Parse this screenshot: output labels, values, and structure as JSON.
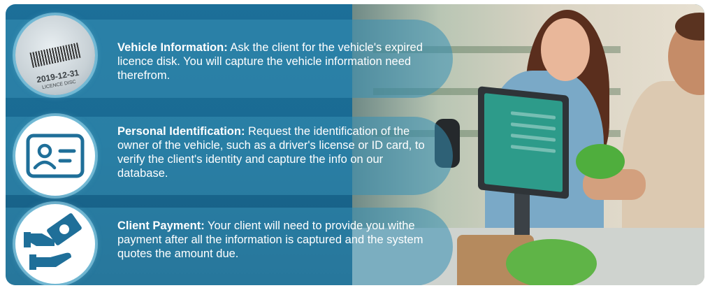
{
  "items": [
    {
      "title": "Vehicle Information:",
      "body": " Ask the client for the vehicle's expired licence disk. You will capture the vehicle information need therefrom.",
      "icon": "licence-disk-icon",
      "disk_date": "2019-12-31",
      "disk_label": "LICENCE DISC"
    },
    {
      "title": "Personal Identification:",
      "body": " Request the identification of the owner of the vehicle, such as a driver's license or ID card, to verify the client's identity and capture the info on our database.",
      "icon": "id-card-icon"
    },
    {
      "title": "Client Payment:",
      "body": " Your client will need to provide you withe payment after all the information is captured and the system quotes the amount due.",
      "icon": "payment-hand-icon"
    }
  ],
  "colors": {
    "primary": "#1c6f99",
    "panel": "#378fb4",
    "icon": "#1f6f99",
    "text": "#ffffff"
  }
}
